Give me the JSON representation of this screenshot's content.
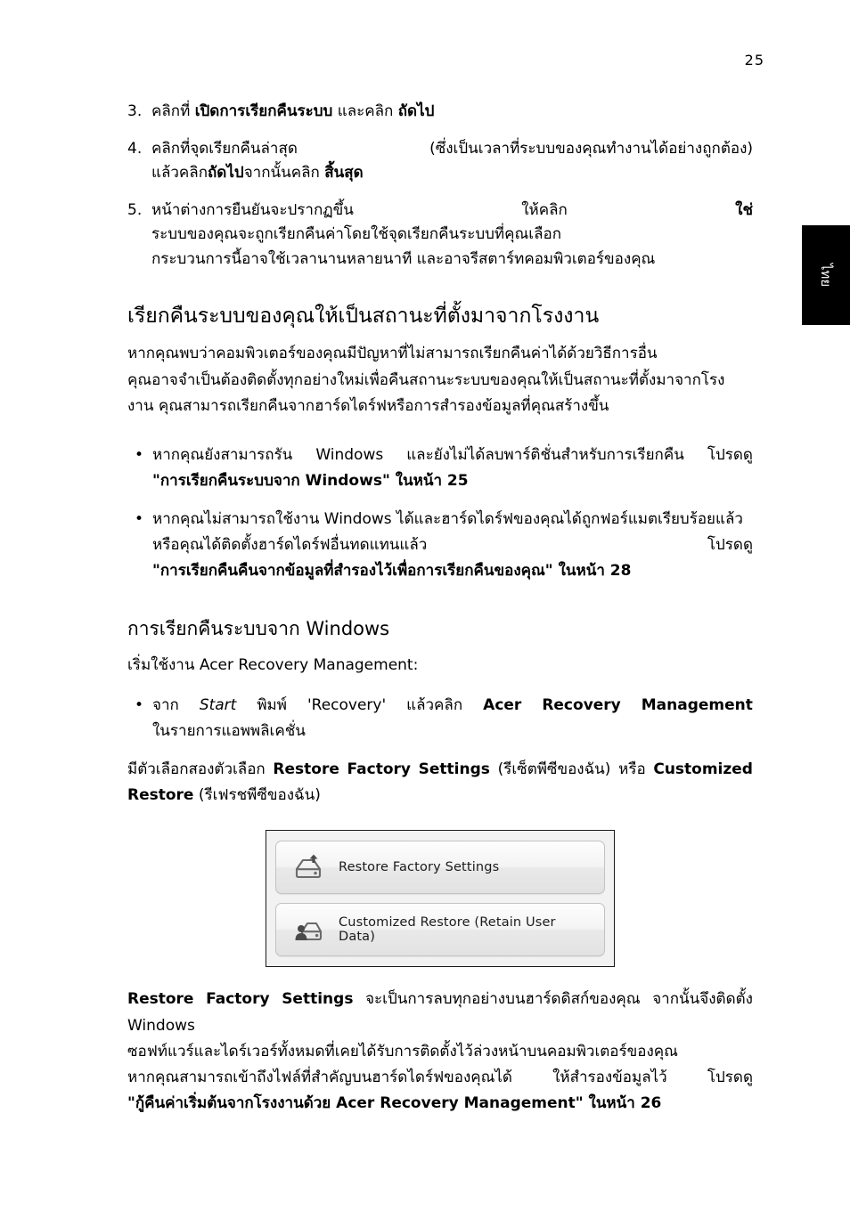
{
  "page": {
    "number": "25",
    "language_tab": "ไทย"
  },
  "steps": [
    {
      "num": "3.",
      "lines": [
        {
          "type": "flow",
          "parts": [
            {
              "text": "คลิกที่ ",
              "style": "normal"
            },
            {
              "text": "เปิดการเรียกคืนระบบ",
              "style": "bold"
            },
            {
              "text": " และคลิก ",
              "style": "normal"
            },
            {
              "text": "ถัดไป",
              "style": "bold"
            }
          ]
        }
      ]
    },
    {
      "num": "4.",
      "lines": [
        {
          "type": "justify",
          "parts": [
            {
              "text": "คลิกที่จุดเรียกคืนล่าสุด",
              "style": "normal"
            },
            {
              "text": "(ซึ่งเป็นเวลาที่ระบบของคุณทำงานได้อย่างถูกต้อง)",
              "style": "normal"
            }
          ]
        },
        {
          "type": "flow",
          "parts": [
            {
              "text": "แล้วคลิก",
              "style": "normal"
            },
            {
              "text": "ถัดไป",
              "style": "bold"
            },
            {
              "text": "จากนั้นคลิก ",
              "style": "normal"
            },
            {
              "text": "สิ้นสุด",
              "style": "bold"
            }
          ]
        }
      ]
    },
    {
      "num": "5.",
      "lines": [
        {
          "type": "justify",
          "parts": [
            {
              "text": "หน้าต่างการยืนยันจะปรากฏขึ้น",
              "style": "normal"
            },
            {
              "text": "ให้คลิก",
              "style": "normal"
            },
            {
              "text": "ใช่",
              "style": "bold"
            }
          ]
        },
        {
          "type": "flow",
          "parts": [
            {
              "text": "ระบบของคุณจะถูกเรียกคืนค่าโดยใช้จุดเรียกคืนระบบที่คุณเลือก",
              "style": "normal"
            }
          ]
        },
        {
          "type": "flow",
          "parts": [
            {
              "text": "กระบวนการนี้อาจใช้เวลานานหลายนาที และอาจรีสตาร์ทคอมพิวเตอร์ของคุณ",
              "style": "normal"
            }
          ]
        }
      ]
    }
  ],
  "section1": {
    "heading": "เรียกคืนระบบของคุณให้เป็นสถานะที่ตั้งมาจากโรงงาน",
    "paragraph_lines": [
      "หากคุณพบว่าคอมพิวเตอร์ของคุณมีปัญหาที่ไม่สามารถเรียกคืนค่าได้ด้วยวิธีการอื่น",
      "คุณอาจจำเป็นต้องติดตั้งทุกอย่างใหม่เพื่อคืนสถานะระบบของคุณให้เป็นสถานะที่ตั้งมาจากโรง",
      "งาน คุณสามารถเรียกคืนจากฮาร์ดไดร์ฟหรือการสำรองข้อมูลที่คุณสร้างขึ้น"
    ],
    "bullets": [
      {
        "lines": [
          {
            "type": "justify",
            "parts": [
              {
                "text": "หากคุณยังสามารถรัน",
                "style": "normal"
              },
              {
                "text": "Windows",
                "style": "normal"
              },
              {
                "text": "และยังไม่ได้ลบพาร์ติชั่นสำหรับการเรียกคืน",
                "style": "normal"
              },
              {
                "text": "โปรดดู",
                "style": "normal"
              }
            ]
          },
          {
            "type": "flow",
            "parts": [
              {
                "text": "\"การเรียกคืนระบบจาก ",
                "style": "bold"
              },
              {
                "text": "Windows",
                "style": "bold"
              },
              {
                "text": "\" ในหน้า 25",
                "style": "bold"
              }
            ]
          }
        ]
      },
      {
        "lines": [
          {
            "type": "flow",
            "parts": [
              {
                "text": "หากคุณไม่สามารถใช้งาน Windows ได้และฮาร์ดไดร์ฟของคุณได้ถูกฟอร์แมตเรียบร้อยแล้ว",
                "style": "normal"
              }
            ]
          },
          {
            "type": "justify",
            "parts": [
              {
                "text": "หรือคุณได้ติดตั้งฮาร์ดไดร์ฟอื่นทดแทนแล้ว",
                "style": "normal"
              },
              {
                "text": "โปรดดู",
                "style": "normal"
              }
            ]
          },
          {
            "type": "flow",
            "parts": [
              {
                "text": "\"การเรียกคืนคืนจากข้อมูลที่สำรองไว้เพื่อการเรียกคืนของคุณ\" ในหน้า 28",
                "style": "bold"
              }
            ]
          }
        ]
      }
    ]
  },
  "section2": {
    "heading": "การเรียกคืนระบบจาก Windows",
    "intro": "เริ่มใช้งาน Acer Recovery Management:",
    "bullet": {
      "lines": [
        {
          "type": "justify",
          "parts": [
            {
              "text": "จาก",
              "style": "normal"
            },
            {
              "text": "Start",
              "style": "italic"
            },
            {
              "text": "พิมพ์",
              "style": "normal"
            },
            {
              "text": "'Recovery'",
              "style": "normal"
            },
            {
              "text": "แล้วคลิก",
              "style": "normal"
            },
            {
              "text": "Acer",
              "style": "bold"
            },
            {
              "text": "Recovery",
              "style": "bold"
            },
            {
              "text": "Management",
              "style": "bold"
            }
          ]
        },
        {
          "type": "flow",
          "parts": [
            {
              "text": "ในรายการแอพพลิเคชั่น",
              "style": "normal"
            }
          ]
        }
      ]
    },
    "options_paragraph": {
      "lines": [
        {
          "type": "justify",
          "parts": [
            {
              "text": "มีตัวเลือกสองตัวเลือก",
              "style": "normal"
            },
            {
              "text": "Restore",
              "style": "bold"
            },
            {
              "text": "Factory",
              "style": "bold"
            },
            {
              "text": "Settings",
              "style": "bold"
            },
            {
              "text": "(รีเซ็ตพีซีของฉัน)",
              "style": "normal"
            },
            {
              "text": "หรือ",
              "style": "normal"
            },
            {
              "text": "Customized",
              "style": "bold"
            }
          ]
        },
        {
          "type": "flow",
          "parts": [
            {
              "text": "Restore",
              "style": "bold"
            },
            {
              "text": " (รีเฟรชพีซีของฉัน)",
              "style": "normal"
            }
          ]
        }
      ]
    }
  },
  "figure": {
    "buttons": [
      {
        "icon": "hard-drive-up-arrow-icon",
        "label": "Restore Factory Settings"
      },
      {
        "icon": "hard-drive-user-icon",
        "label": "Customized Restore (Retain User Data)"
      }
    ]
  },
  "section3": {
    "lines": [
      {
        "type": "justify",
        "parts": [
          {
            "text": "Restore",
            "style": "bold"
          },
          {
            "text": "Factory",
            "style": "bold"
          },
          {
            "text": "Settings",
            "style": "bold"
          },
          {
            "text": "จะเป็นการลบทุกอย่างบนฮาร์ดดิสก์ของคุณ",
            "style": "normal"
          },
          {
            "text": "จากนั้นจึงติดตั้ง",
            "style": "normal"
          }
        ]
      },
      {
        "type": "flow",
        "parts": [
          {
            "text": "Windows",
            "style": "normal"
          }
        ]
      },
      {
        "type": "flow",
        "parts": [
          {
            "text": "ซอฟท์แวร์และไดร์เวอร์ทั้งหมดที่เคยได้รับการติดตั้งไว้ล่วงหน้าบนคอมพิวเตอร์ของคุณ",
            "style": "normal"
          }
        ]
      },
      {
        "type": "justify",
        "parts": [
          {
            "text": "หากคุณสามารถเข้าถึงไฟล์ที่สำคัญบนฮาร์ดไดร์ฟของคุณได้",
            "style": "normal"
          },
          {
            "text": "ให้สำรองข้อมูลไว้",
            "style": "normal"
          },
          {
            "text": "โปรดดู",
            "style": "normal"
          }
        ]
      },
      {
        "type": "flow",
        "parts": [
          {
            "text": "\"กู้คืนค่าเริ่มต้นจากโรงงานด้วย Acer Recovery Management\" ในหน้า 26",
            "style": "bold"
          }
        ]
      }
    ]
  }
}
